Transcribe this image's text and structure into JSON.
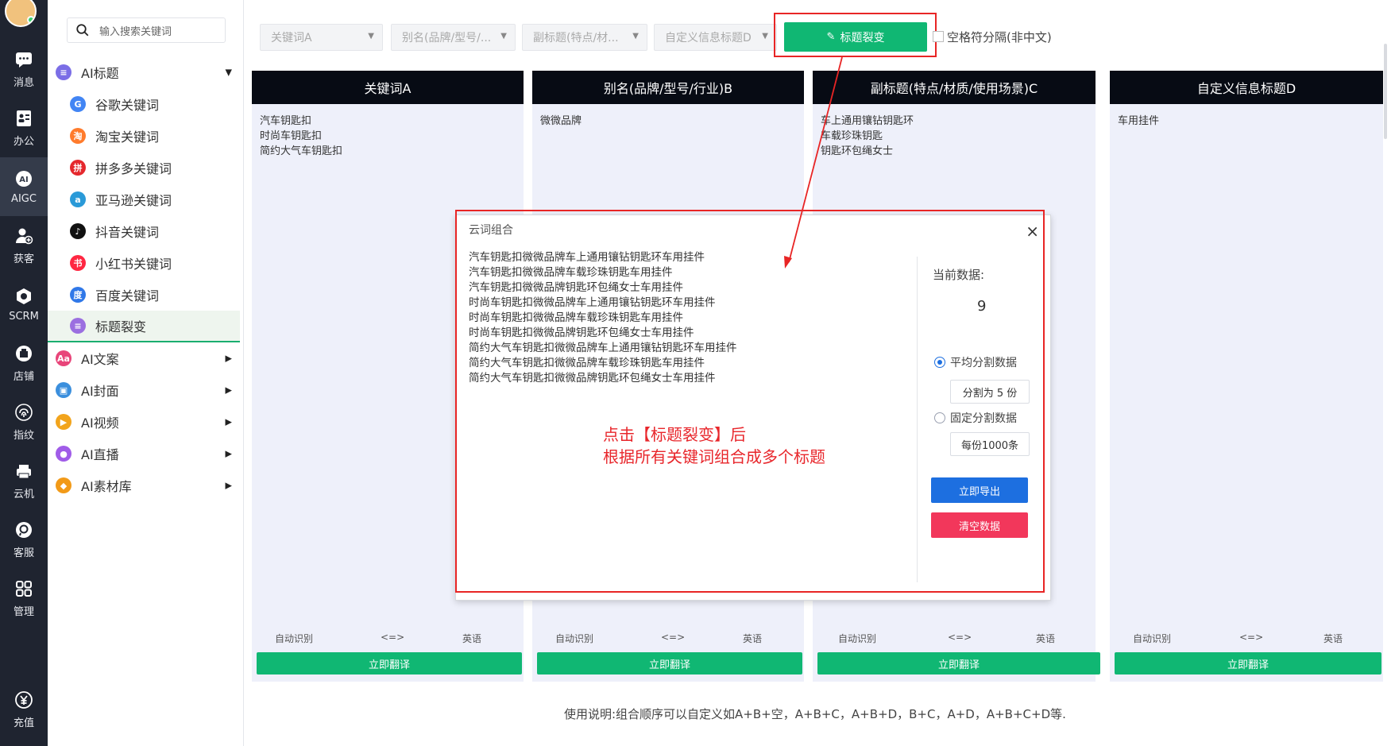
{
  "rail": {
    "items": [
      {
        "label": "消息",
        "icon": "chat-icon"
      },
      {
        "label": "办公",
        "icon": "office-icon"
      },
      {
        "label": "AIGC",
        "icon": "ai-icon",
        "active": true
      },
      {
        "label": "获客",
        "icon": "user-add-icon"
      },
      {
        "label": "SCRM",
        "icon": "gear-box-icon"
      },
      {
        "label": "店铺",
        "icon": "store-icon"
      },
      {
        "label": "指纹",
        "icon": "fingerprint-icon"
      },
      {
        "label": "云机",
        "icon": "cloud-machine-icon"
      },
      {
        "label": "客服",
        "icon": "headset-icon"
      },
      {
        "label": "管理",
        "icon": "grid-icon"
      },
      {
        "label": "充值",
        "icon": "yen-icon"
      }
    ]
  },
  "sidebar": {
    "search_placeholder": "输入搜索关键词",
    "groups": [
      {
        "label": "AI标题",
        "color": "#7b6ee6"
      },
      {
        "label": "AI文案",
        "color": "#e8457a"
      },
      {
        "label": "AI封面",
        "color": "#3b8fdd"
      },
      {
        "label": "AI视频",
        "color": "#f2a41c"
      },
      {
        "label": "AI直播",
        "color": "#a05ce8"
      },
      {
        "label": "AI素材库",
        "color": "#f29a18"
      }
    ],
    "sub_items": [
      {
        "label": "谷歌关键词",
        "color": "#4285f4",
        "glyph": "G"
      },
      {
        "label": "淘宝关键词",
        "color": "#ff7b2c",
        "glyph": "淘"
      },
      {
        "label": "拼多多关键词",
        "color": "#e5282d",
        "glyph": "拼"
      },
      {
        "label": "亚马逊关键词",
        "color": "#2a9ad8",
        "glyph": "a"
      },
      {
        "label": "抖音关键词",
        "color": "#111111",
        "glyph": "♪"
      },
      {
        "label": "小红书关键词",
        "color": "#ff2742",
        "glyph": "书"
      },
      {
        "label": "百度关键词",
        "color": "#3078e8",
        "glyph": "度"
      },
      {
        "label": "标题裂变",
        "color": "#9b6fe0",
        "glyph": "≡"
      }
    ]
  },
  "toolbar": {
    "selects": [
      "关键词A",
      "别名(品牌/型号/...",
      "副标题(特点/材...",
      "自定义信息标题D"
    ],
    "fission_button": "标题裂变",
    "space_checkbox": "空格符分隔(非中文)"
  },
  "columns": [
    {
      "title": "关键词A",
      "lines": [
        "汽车钥匙扣",
        "时尚车钥匙扣",
        "简约大气车钥匙扣"
      ]
    },
    {
      "title": "别名(品牌/型号/行业)B",
      "lines": [
        "微微品牌"
      ]
    },
    {
      "title": "副标题(特点/材质/使用场景)C",
      "lines": [
        "车上通用镶钻钥匙环",
        "车载珍珠钥匙",
        "钥匙环包绳女士"
      ]
    },
    {
      "title": "自定义信息标题D",
      "lines": [
        "车用挂件"
      ]
    }
  ],
  "column_footer": {
    "left": "自动识别",
    "mid": "<=>",
    "right": "英语",
    "button": "立即翻译"
  },
  "footnote": "使用说明:组合顺序可以自定义如A+B+空，A+B+C，A+B+D，B+C，A+D，A+B+C+D等.",
  "modal": {
    "title": "云词组合",
    "close": "×",
    "results": [
      "汽车钥匙扣微微品牌车上通用镶钻钥匙环车用挂件",
      "汽车钥匙扣微微品牌车载珍珠钥匙车用挂件",
      "汽车钥匙扣微微品牌钥匙环包绳女士车用挂件",
      "时尚车钥匙扣微微品牌车上通用镶钻钥匙环车用挂件",
      "时尚车钥匙扣微微品牌车载珍珠钥匙车用挂件",
      "时尚车钥匙扣微微品牌钥匙环包绳女士车用挂件",
      "简约大气车钥匙扣微微品牌车上通用镶钻钥匙环车用挂件",
      "简约大气车钥匙扣微微品牌车载珍珠钥匙车用挂件",
      "简约大气车钥匙扣微微品牌钥匙环包绳女士车用挂件"
    ],
    "annotation_line1": "点击【标题裂变】后",
    "annotation_line2": "根据所有关键词组合成多个标题",
    "current_label": "当前数据:",
    "current_value": "9",
    "radio_even": "平均分割数据",
    "even_input": "分割为 5 份",
    "radio_fixed": "固定分割数据",
    "fixed_input": "每份1000条",
    "export_button": "立即导出",
    "clear_button": "清空数据",
    "colors": {
      "export": "#1d6fe0",
      "clear": "#f2375b",
      "annotation": "#e8262b"
    }
  }
}
